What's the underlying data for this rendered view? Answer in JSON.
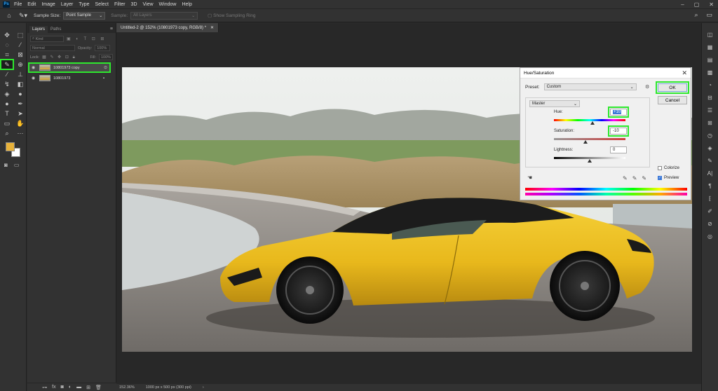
{
  "menubar": {
    "logo": "Ps",
    "items": [
      "File",
      "Edit",
      "Image",
      "Layer",
      "Type",
      "Select",
      "Filter",
      "3D",
      "View",
      "Window",
      "Help"
    ],
    "window_controls": [
      "–",
      "▢",
      "✕"
    ]
  },
  "options_bar": {
    "sample_size_label": "Sample Size:",
    "sample_size_value": "Point Sample",
    "sample_label": "Sample:",
    "sample_value": "All Layers",
    "show_ring_label": "Show Sampling Ring"
  },
  "layers_panel": {
    "tabs": [
      "Layers",
      "Paths"
    ],
    "search_placeholder": "Kind",
    "blend_mode": "Normal",
    "opacity_label": "Opacity:",
    "opacity_value": "100%",
    "lock_label": "Lock:",
    "fill_label": "Fill:",
    "fill_value": "100%",
    "layers": [
      {
        "name": "10801973 copy",
        "selected": true
      },
      {
        "name": "10801973",
        "selected": false
      }
    ],
    "footer_icons": [
      "link-icon",
      "fx-icon",
      "mask-icon",
      "adjustment-icon",
      "folder-icon",
      "new-layer-icon",
      "trash-icon"
    ]
  },
  "document": {
    "tab_title": "Untitled-2 @ 152% (10801973 copy, RGB/8) *",
    "tab_close": "✕"
  },
  "status_bar": {
    "zoom": "152.36%",
    "doc_size": "1000 px x 500 px (300 ppi)"
  },
  "dialog": {
    "title": "Hue/Saturation",
    "preset_label": "Preset:",
    "preset_value": "Custom",
    "ok_label": "OK",
    "cancel_label": "Cancel",
    "channel": "Master",
    "hue_label": "Hue:",
    "hue_value": "+10",
    "saturation_label": "Saturation:",
    "saturation_value": "-10",
    "lightness_label": "Lightness:",
    "lightness_value": "0",
    "colorize_label": "Colorize",
    "preview_label": "Preview",
    "colorize_checked": false,
    "preview_checked": true
  },
  "colors": {
    "highlight": "#2ee82e",
    "foreground_swatch": "#e8b23a",
    "background_swatch": "#ffffff",
    "car_yellow": "#f0c020"
  }
}
